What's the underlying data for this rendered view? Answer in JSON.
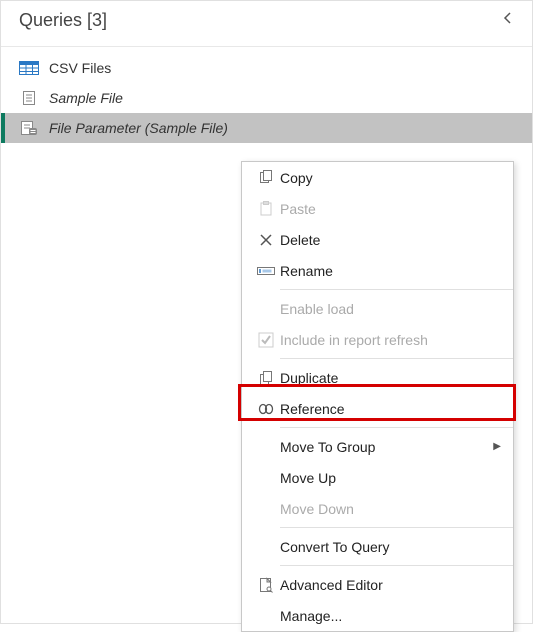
{
  "header": {
    "title": "Queries [3]"
  },
  "queries": [
    {
      "label": "CSV Files",
      "italic": false,
      "selected": false,
      "icon": "table-icon"
    },
    {
      "label": "Sample File",
      "italic": true,
      "selected": false,
      "icon": "file-icon"
    },
    {
      "label": "File Parameter (Sample File)",
      "italic": true,
      "selected": true,
      "icon": "parameter-icon"
    }
  ],
  "context_menu": {
    "items": [
      {
        "label": "Copy",
        "icon": "copy-icon",
        "enabled": true
      },
      {
        "label": "Paste",
        "icon": "paste-icon",
        "enabled": false
      },
      {
        "label": "Delete",
        "icon": "delete-icon",
        "enabled": true
      },
      {
        "label": "Rename",
        "icon": "rename-icon",
        "enabled": true
      },
      {
        "sep": true
      },
      {
        "label": "Enable load",
        "icon": "",
        "enabled": false
      },
      {
        "label": "Include in report refresh",
        "icon": "check-icon",
        "enabled": false
      },
      {
        "sep": true
      },
      {
        "label": "Duplicate",
        "icon": "duplicate-icon",
        "enabled": true
      },
      {
        "label": "Reference",
        "icon": "reference-icon",
        "enabled": true,
        "highlighted": true
      },
      {
        "sep": true
      },
      {
        "label": "Move To Group",
        "icon": "",
        "enabled": true,
        "submenu": true
      },
      {
        "label": "Move Up",
        "icon": "",
        "enabled": true
      },
      {
        "label": "Move Down",
        "icon": "",
        "enabled": false
      },
      {
        "sep": true
      },
      {
        "label": "Convert To Query",
        "icon": "",
        "enabled": true
      },
      {
        "sep": true
      },
      {
        "label": "Advanced Editor",
        "icon": "editor-icon",
        "enabled": true
      },
      {
        "label": "Manage...",
        "icon": "",
        "enabled": true
      }
    ]
  }
}
